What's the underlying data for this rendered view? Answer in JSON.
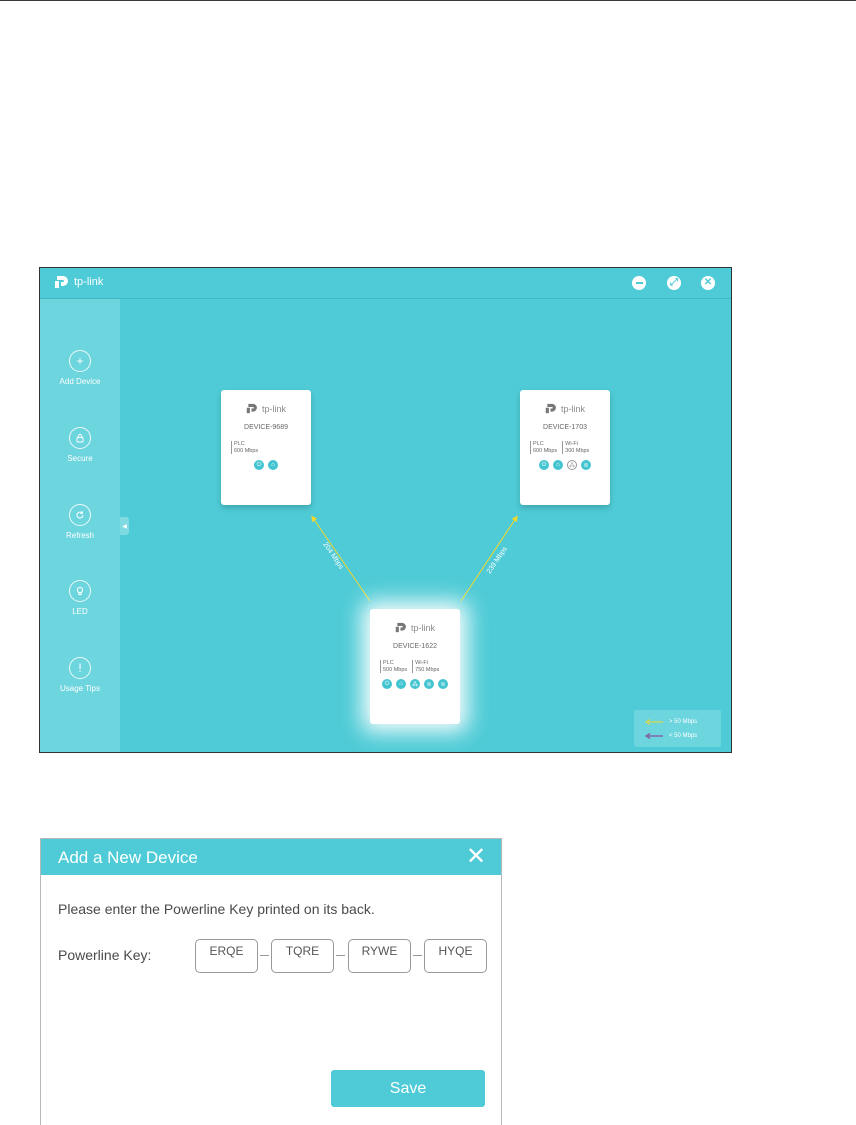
{
  "app": {
    "logo_text": "tp-link",
    "window_controls": [
      "minimize-icon",
      "restore-icon",
      "close-icon"
    ],
    "sidebar": [
      {
        "label": "Add Device",
        "icon": "plus-icon"
      },
      {
        "label": "Secure",
        "icon": "lock-icon"
      },
      {
        "label": "Refresh",
        "icon": "refresh-icon"
      },
      {
        "label": "LED",
        "icon": "bulb-icon"
      },
      {
        "label": "Usage Tips",
        "icon": "exclamation-icon"
      }
    ],
    "devices": [
      {
        "name": "DEVICE-9689",
        "stats": [
          {
            "type": "PLC",
            "rate": "600 Mbps"
          }
        ],
        "icons": [
          "power-icon",
          "home-icon"
        ]
      },
      {
        "name": "DEVICE-1703",
        "stats": [
          {
            "type": "PLC",
            "rate": "600 Mbps"
          },
          {
            "type": "Wi-Fi",
            "rate": "300 Mbps"
          }
        ],
        "icons": [
          "power-icon",
          "home-icon",
          "network-icon",
          "wifi-icon"
        ]
      },
      {
        "name": "DEVICE-1622",
        "stats": [
          {
            "type": "PLC",
            "rate": "500 Mbps"
          },
          {
            "type": "Wi-Fi",
            "rate": "750 Mbps"
          }
        ],
        "icons": [
          "power-icon",
          "home-icon",
          "network-icon",
          "wifi-icon",
          "wifi-icon"
        ]
      }
    ],
    "links": [
      {
        "label": "204 Mbps",
        "color": "#f3d82a"
      },
      {
        "label": "239 Mbps",
        "color": "#f3d82a"
      }
    ],
    "legend": [
      {
        "label": "> 50 Mbps",
        "color": "#f3d82a"
      },
      {
        "label": "< 50 Mbps",
        "color": "#8a2f8f"
      }
    ],
    "colors": {
      "accent": "#4ecbd6",
      "sidebar": "#6dd5de"
    }
  },
  "dialog": {
    "title": "Add a New Device",
    "prompt": "Please enter the Powerline Key printed on its back.",
    "key_label": "Powerline Key:",
    "key_segments": [
      "ERQE",
      "TQRE",
      "RYWE",
      "HYQE"
    ],
    "save_label": "Save"
  }
}
